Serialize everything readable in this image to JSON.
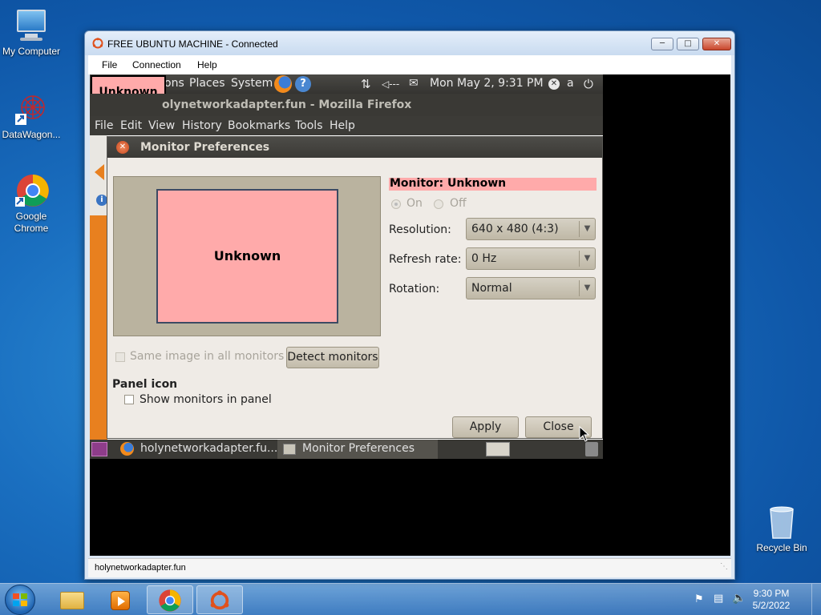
{
  "desktop": {
    "icons": [
      {
        "label": "My Computer"
      },
      {
        "label": "DataWagon..."
      },
      {
        "label": "Google Chrome"
      },
      {
        "label": "Recycle Bin"
      }
    ]
  },
  "rdp": {
    "title": "FREE UBUNTU MACHINE - Connected",
    "menu": [
      "File",
      "Connection",
      "Help"
    ],
    "status": "holynetworkadapter.fun"
  },
  "gnome": {
    "panel": {
      "partial_menu": "ons",
      "places": "Places",
      "system": "System",
      "clock": "Mon May  2,  9:31 PM",
      "user": "a"
    },
    "badge": "Unknown",
    "firefox_title": "olynetworkadapter.fun - Mozilla Firefox",
    "firefox_menu": [
      "File",
      "Edit",
      "View",
      "History",
      "Bookmarks",
      "Tools",
      "Help"
    ],
    "taskbar": {
      "firefox": "holynetworkadapter.fu...",
      "monitor": "Monitor Preferences"
    }
  },
  "dialog": {
    "title": "Monitor Preferences",
    "preview_label": "Unknown",
    "monitor_heading": "Monitor: Unknown",
    "on": "On",
    "off": "Off",
    "resolution_label": "Resolution:",
    "resolution_value": "640 x 480 (4:3)",
    "refresh_label": "Refresh rate:",
    "refresh_value": "0 Hz",
    "rotation_label": "Rotation:",
    "rotation_value": "Normal",
    "same_image": "Same image in all monitors",
    "detect": "Detect monitors",
    "panel_icon": "Panel icon",
    "show_monitors": "Show monitors in panel",
    "apply": "Apply",
    "close": "Close"
  },
  "clock": {
    "time": "9:30 PM",
    "date": "5/2/2022"
  },
  "colors": {
    "highlight_pink": "#ffaaaa",
    "gnome_dark": "#3c3b37",
    "dialog_bg": "#efebe6"
  }
}
